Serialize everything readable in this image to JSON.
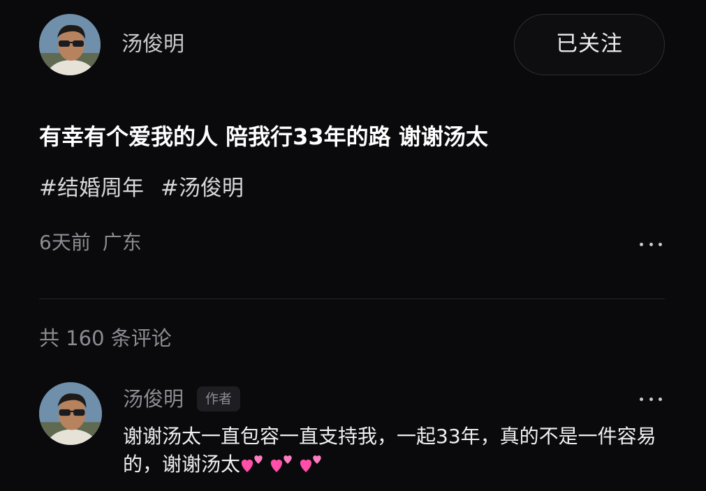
{
  "post": {
    "author": {
      "name": "汤俊明",
      "avatar_icon": "user-photo-avatar"
    },
    "follow_button_label": "已关注",
    "text": "有幸有个爱我的人 陪我行33年的路 谢谢汤太",
    "tags": [
      "#结婚周年",
      "#汤俊明"
    ],
    "meta": {
      "time": "6天前",
      "location": "广东"
    },
    "more_icon": "more-dots-icon"
  },
  "comments_section": {
    "count_label": "共 160 条评论",
    "comments": [
      {
        "author_name": "汤俊明",
        "badge": "作者",
        "text": "谢谢汤太一直包容一直支持我，一起33年，真的不是一件容易的，谢谢汤太",
        "emojis": [
          "two-hearts-icon",
          "two-hearts-icon",
          "two-hearts-icon"
        ]
      }
    ]
  },
  "colors": {
    "background": "#0a0a0c",
    "primary_text": "#ffffff",
    "secondary_text": "#8c8c93",
    "heart_pink": "#ff4fa8"
  }
}
